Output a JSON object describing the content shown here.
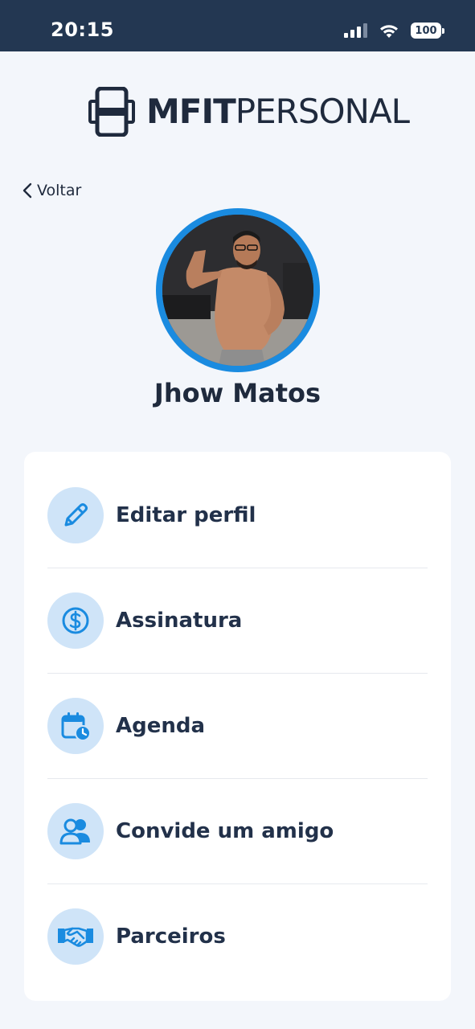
{
  "status_bar": {
    "time": "20:15",
    "battery": "100",
    "icons": [
      "cellular-signal-icon",
      "wifi-icon",
      "battery-icon"
    ]
  },
  "brand": {
    "bold": "MFIT",
    "light": "PERSONAL",
    "icon": "dumbbell-logo-icon"
  },
  "nav": {
    "back_label": "Voltar",
    "back_icon": "chevron-left-icon"
  },
  "profile": {
    "name": "Jhow Matos",
    "avatar_icon": "profile-photo",
    "ring_color": "#1a8be0"
  },
  "menu": {
    "items": [
      {
        "label": "Editar perfil",
        "icon": "pencil-icon"
      },
      {
        "label": "Assinatura",
        "icon": "dollar-coin-icon"
      },
      {
        "label": "Agenda",
        "icon": "calendar-clock-icon"
      },
      {
        "label": "Convide um amigo",
        "icon": "users-icon"
      },
      {
        "label": "Parceiros",
        "icon": "handshake-icon"
      }
    ]
  },
  "colors": {
    "header_bg": "#233752",
    "page_bg": "#f3f6fb",
    "accent": "#1a8be0",
    "icon_bg": "#cfe4f8",
    "text": "#1f2a3d"
  }
}
